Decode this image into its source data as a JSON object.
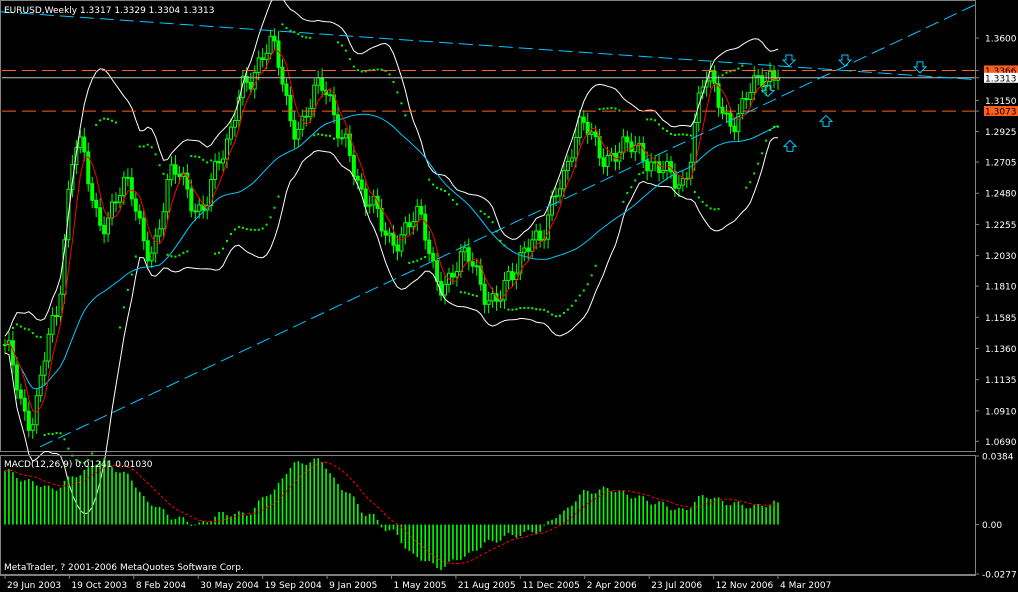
{
  "chart_data": [
    {
      "type": "candlestick",
      "header": "EURUSD,Weekly  1.3317 1.3329 1.3304 1.3313",
      "symbol": "EURUSD",
      "timeframe": "Weekly",
      "last_bar": {
        "open": 1.3317,
        "high": 1.3329,
        "low": 1.3304,
        "close": 1.3313
      },
      "ylim": [
        1.062,
        1.386
      ],
      "y_ticks": [
        "1.3600",
        "1.3366",
        "1.3313",
        "1.3150",
        "1.3073",
        "1.2925",
        "1.2705",
        "1.2480",
        "1.2255",
        "1.2030",
        "1.1810",
        "1.1585",
        "1.1360",
        "1.1135",
        "1.0910",
        "1.0690"
      ],
      "colors": {
        "bull": "#00ff00",
        "bear": "#00ff00",
        "bollinger": "#ffffff",
        "ma_fast": "#ff0000",
        "ma_slow": "#00c8ff",
        "sar": "#00ff00",
        "level": "#ff6020",
        "trendline": "#00c8ff",
        "price_line": "#c0c0c0",
        "arrow": "#00c8ff"
      },
      "anchor_prices": [
        1.135,
        1.085,
        1.15,
        1.29,
        1.22,
        1.26,
        1.2,
        1.27,
        1.23,
        1.28,
        1.325,
        1.36,
        1.29,
        1.33,
        1.285,
        1.245,
        1.21,
        1.235,
        1.18,
        1.205,
        1.17,
        1.19,
        1.215,
        1.255,
        1.3,
        1.27,
        1.285,
        1.265,
        1.255,
        1.33,
        1.3,
        1.325,
        1.3313
      ],
      "horizontal_levels": [
        {
          "price": 1.3366,
          "label": "1.3366",
          "style": "dashed",
          "color": "#ff6020"
        },
        {
          "price": 1.3073,
          "label": "1.3073",
          "style": "dashed",
          "color": "#ff6020"
        },
        {
          "price": 1.3313,
          "label": "1.3313",
          "style": "solid",
          "color": "#c0c0c0"
        }
      ],
      "down_arrows": [
        1.342,
        1.342,
        1.337,
        1.32
      ],
      "up_arrows": [
        1.302,
        1.284
      ],
      "indicators": [
        "Bollinger Bands",
        "Moving Average (fast)",
        "Moving Average (slow)",
        "Parabolic SAR"
      ]
    },
    {
      "type": "macd",
      "label": "MACD(12,26,9) 0.01241 0.01030",
      "params": "12,26,9",
      "main": 0.01241,
      "signal": 0.0103,
      "ylim": [
        -0.0277,
        0.0384
      ],
      "y_ticks": [
        "0.0384",
        "0.00",
        "-0.0277"
      ],
      "colors": {
        "histogram": "#00ff00",
        "signal": "#ff0000"
      },
      "histogram_anchors": [
        0.03,
        0.024,
        0.02,
        0.028,
        0.036,
        0.028,
        0.012,
        0.004,
        0.0,
        0.006,
        0.006,
        0.018,
        0.034,
        0.036,
        0.02,
        0.006,
        -0.004,
        -0.018,
        -0.024,
        -0.018,
        -0.01,
        -0.006,
        -0.004,
        0.006,
        0.018,
        0.02,
        0.016,
        0.012,
        0.008,
        0.016,
        0.012,
        0.01,
        0.01241
      ]
    }
  ],
  "x_axis": {
    "labels": [
      "29 Jun 2003",
      "19 Oct 2003",
      "8 Feb 2004",
      "30 May 2004",
      "19 Sep 2004",
      "9 Jan 2005",
      "1 May 2005",
      "21 Aug 2005",
      "11 Dec 2005",
      "2 Apr 2006",
      "23 Jul 2006",
      "12 Nov 2006",
      "4 Mar 2007"
    ]
  },
  "copyright": "MetaTrader, ? 2001-2006 MetaQuotes Software Corp."
}
